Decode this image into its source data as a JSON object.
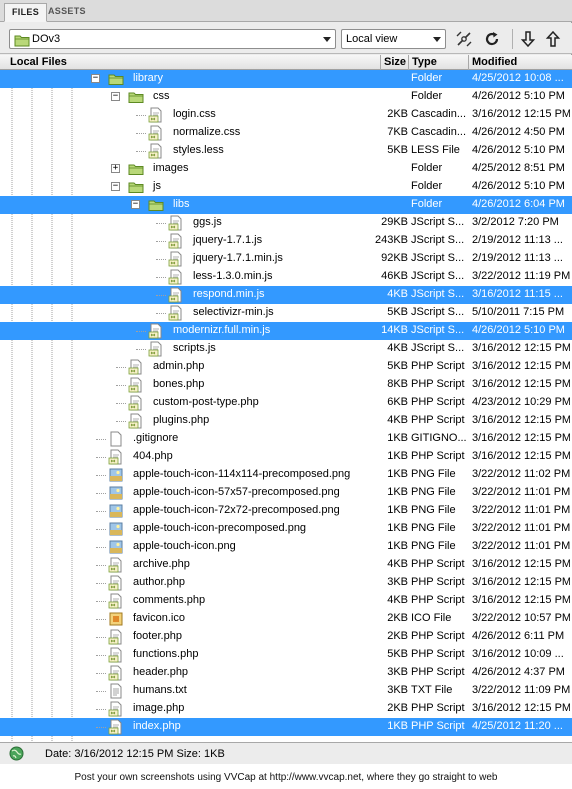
{
  "tabs": [
    {
      "label": "FILES"
    },
    {
      "label": "ASSETS"
    }
  ],
  "toolbar": {
    "site_value": "DOv3",
    "view_value": "Local view"
  },
  "columns": {
    "name": "Local Files",
    "size": "Size",
    "type": "Type",
    "modified": "Modified"
  },
  "rows": [
    {
      "name": "library",
      "size": "",
      "type": "Folder",
      "modified": "4/25/2012 10:08 ...",
      "icon": "folder-icon",
      "depth": 1,
      "expander": "minus",
      "selected": true
    },
    {
      "name": "css",
      "size": "",
      "type": "Folder",
      "modified": "4/26/2012 5:10 PM",
      "icon": "folder-icon",
      "depth": 2,
      "expander": "minus",
      "selected": false
    },
    {
      "name": "login.css",
      "size": "2KB",
      "type": "Cascadin...",
      "modified": "3/16/2012 12:15 PM",
      "icon": "code-file-icon",
      "depth": 3,
      "expander": "",
      "selected": false
    },
    {
      "name": "normalize.css",
      "size": "7KB",
      "type": "Cascadin...",
      "modified": "4/26/2012 4:50 PM",
      "icon": "code-file-icon",
      "depth": 3,
      "expander": "",
      "selected": false
    },
    {
      "name": "styles.less",
      "size": "5KB",
      "type": "LESS File",
      "modified": "4/26/2012 5:10 PM",
      "icon": "code-file-icon",
      "depth": 3,
      "expander": "",
      "selected": false
    },
    {
      "name": "images",
      "size": "",
      "type": "Folder",
      "modified": "4/25/2012 8:51 PM",
      "icon": "folder-icon",
      "depth": 2,
      "expander": "plus",
      "selected": false
    },
    {
      "name": "js",
      "size": "",
      "type": "Folder",
      "modified": "4/26/2012 5:10 PM",
      "icon": "folder-icon",
      "depth": 2,
      "expander": "minus",
      "selected": false
    },
    {
      "name": "libs",
      "size": "",
      "type": "Folder",
      "modified": "4/26/2012 6:04 PM",
      "icon": "folder-icon",
      "depth": 3,
      "expander": "minus",
      "selected": true
    },
    {
      "name": "ggs.js",
      "size": "29KB",
      "type": "JScript S...",
      "modified": "3/2/2012 7:20 PM",
      "icon": "code-file-icon",
      "depth": 4,
      "expander": "",
      "selected": false
    },
    {
      "name": "jquery-1.7.1.js",
      "size": "243KB",
      "type": "JScript S...",
      "modified": "2/19/2012 11:13 ...",
      "icon": "code-file-icon",
      "depth": 4,
      "expander": "",
      "selected": false
    },
    {
      "name": "jquery-1.7.1.min.js",
      "size": "92KB",
      "type": "JScript S...",
      "modified": "2/19/2012 11:13 ...",
      "icon": "code-file-icon",
      "depth": 4,
      "expander": "",
      "selected": false
    },
    {
      "name": "less-1.3.0.min.js",
      "size": "46KB",
      "type": "JScript S...",
      "modified": "3/22/2012 11:19 PM",
      "icon": "code-file-icon",
      "depth": 4,
      "expander": "",
      "selected": false
    },
    {
      "name": "respond.min.js",
      "size": "4KB",
      "type": "JScript S...",
      "modified": "3/16/2012 11:15 ...",
      "icon": "code-file-icon",
      "depth": 4,
      "expander": "",
      "selected": true
    },
    {
      "name": "selectivizr-min.js",
      "size": "5KB",
      "type": "JScript S...",
      "modified": "5/10/2011 7:15 PM",
      "icon": "code-file-icon",
      "depth": 4,
      "expander": "",
      "selected": false
    },
    {
      "name": "modernizr.full.min.js",
      "size": "14KB",
      "type": "JScript S...",
      "modified": "4/26/2012 5:10 PM",
      "icon": "code-file-icon",
      "depth": 3,
      "expander": "",
      "selected": true
    },
    {
      "name": "scripts.js",
      "size": "4KB",
      "type": "JScript S...",
      "modified": "3/16/2012 12:15 PM",
      "icon": "code-file-icon",
      "depth": 3,
      "expander": "",
      "selected": false
    },
    {
      "name": "admin.php",
      "size": "5KB",
      "type": "PHP Script",
      "modified": "3/16/2012 12:15 PM",
      "icon": "code-file-icon",
      "depth": 2,
      "expander": "",
      "selected": false
    },
    {
      "name": "bones.php",
      "size": "8KB",
      "type": "PHP Script",
      "modified": "3/16/2012 12:15 PM",
      "icon": "code-file-icon",
      "depth": 2,
      "expander": "",
      "selected": false
    },
    {
      "name": "custom-post-type.php",
      "size": "6KB",
      "type": "PHP Script",
      "modified": "4/23/2012 10:29 PM",
      "icon": "code-file-icon",
      "depth": 2,
      "expander": "",
      "selected": false
    },
    {
      "name": "plugins.php",
      "size": "4KB",
      "type": "PHP Script",
      "modified": "3/16/2012 12:15 PM",
      "icon": "code-file-icon",
      "depth": 2,
      "expander": "",
      "selected": false
    },
    {
      "name": ".gitignore",
      "size": "1KB",
      "type": "GITIGNO...",
      "modified": "3/16/2012 12:15 PM",
      "icon": "blank-file-icon",
      "depth": 1,
      "expander": "",
      "selected": false
    },
    {
      "name": "404.php",
      "size": "1KB",
      "type": "PHP Script",
      "modified": "3/16/2012 12:15 PM",
      "icon": "code-file-icon",
      "depth": 1,
      "expander": "",
      "selected": false
    },
    {
      "name": "apple-touch-icon-114x114-precomposed.png",
      "size": "1KB",
      "type": "PNG File",
      "modified": "3/22/2012 11:02 PM",
      "icon": "image-file-icon",
      "depth": 1,
      "expander": "",
      "selected": false
    },
    {
      "name": "apple-touch-icon-57x57-precomposed.png",
      "size": "1KB",
      "type": "PNG File",
      "modified": "3/22/2012 11:01 PM",
      "icon": "image-file-icon",
      "depth": 1,
      "expander": "",
      "selected": false
    },
    {
      "name": "apple-touch-icon-72x72-precomposed.png",
      "size": "1KB",
      "type": "PNG File",
      "modified": "3/22/2012 11:01 PM",
      "icon": "image-file-icon",
      "depth": 1,
      "expander": "",
      "selected": false
    },
    {
      "name": "apple-touch-icon-precomposed.png",
      "size": "1KB",
      "type": "PNG File",
      "modified": "3/22/2012 11:01 PM",
      "icon": "image-file-icon",
      "depth": 1,
      "expander": "",
      "selected": false
    },
    {
      "name": "apple-touch-icon.png",
      "size": "1KB",
      "type": "PNG File",
      "modified": "3/22/2012 11:01 PM",
      "icon": "image-file-icon",
      "depth": 1,
      "expander": "",
      "selected": false
    },
    {
      "name": "archive.php",
      "size": "4KB",
      "type": "PHP Script",
      "modified": "3/16/2012 12:15 PM",
      "icon": "code-file-icon",
      "depth": 1,
      "expander": "",
      "selected": false
    },
    {
      "name": "author.php",
      "size": "3KB",
      "type": "PHP Script",
      "modified": "3/16/2012 12:15 PM",
      "icon": "code-file-icon",
      "depth": 1,
      "expander": "",
      "selected": false
    },
    {
      "name": "comments.php",
      "size": "4KB",
      "type": "PHP Script",
      "modified": "3/16/2012 12:15 PM",
      "icon": "code-file-icon",
      "depth": 1,
      "expander": "",
      "selected": false
    },
    {
      "name": "favicon.ico",
      "size": "2KB",
      "type": "ICO File",
      "modified": "3/22/2012 10:57 PM",
      "icon": "ico-file-icon",
      "depth": 1,
      "expander": "",
      "selected": false
    },
    {
      "name": "footer.php",
      "size": "2KB",
      "type": "PHP Script",
      "modified": "4/26/2012 6:11 PM",
      "icon": "code-file-icon",
      "depth": 1,
      "expander": "",
      "selected": false
    },
    {
      "name": "functions.php",
      "size": "5KB",
      "type": "PHP Script",
      "modified": "3/16/2012 10:09 ...",
      "icon": "code-file-icon",
      "depth": 1,
      "expander": "",
      "selected": false
    },
    {
      "name": "header.php",
      "size": "3KB",
      "type": "PHP Script",
      "modified": "4/26/2012 4:37 PM",
      "icon": "code-file-icon",
      "depth": 1,
      "expander": "",
      "selected": false
    },
    {
      "name": "humans.txt",
      "size": "3KB",
      "type": "TXT File",
      "modified": "3/22/2012 11:09 PM",
      "icon": "text-file-icon",
      "depth": 1,
      "expander": "",
      "selected": false
    },
    {
      "name": "image.php",
      "size": "2KB",
      "type": "PHP Script",
      "modified": "3/16/2012 12:15 PM",
      "icon": "code-file-icon",
      "depth": 1,
      "expander": "",
      "selected": false
    },
    {
      "name": "index.php",
      "size": "1KB",
      "type": "PHP Script",
      "modified": "4/25/2012 11:20 ...",
      "icon": "code-file-icon",
      "depth": 1,
      "expander": "",
      "selected": true
    }
  ],
  "status": {
    "text": "Date: 3/16/2012 12:15 PM  Size: 1KB"
  },
  "footer": {
    "text": "Post your own screenshots using VVCap at http://www.vvcap.net, where they go straight to web"
  },
  "colors": {
    "selection": "#3399ff",
    "panel": "#ececec",
    "tree_lines": "#a0a0a0"
  }
}
